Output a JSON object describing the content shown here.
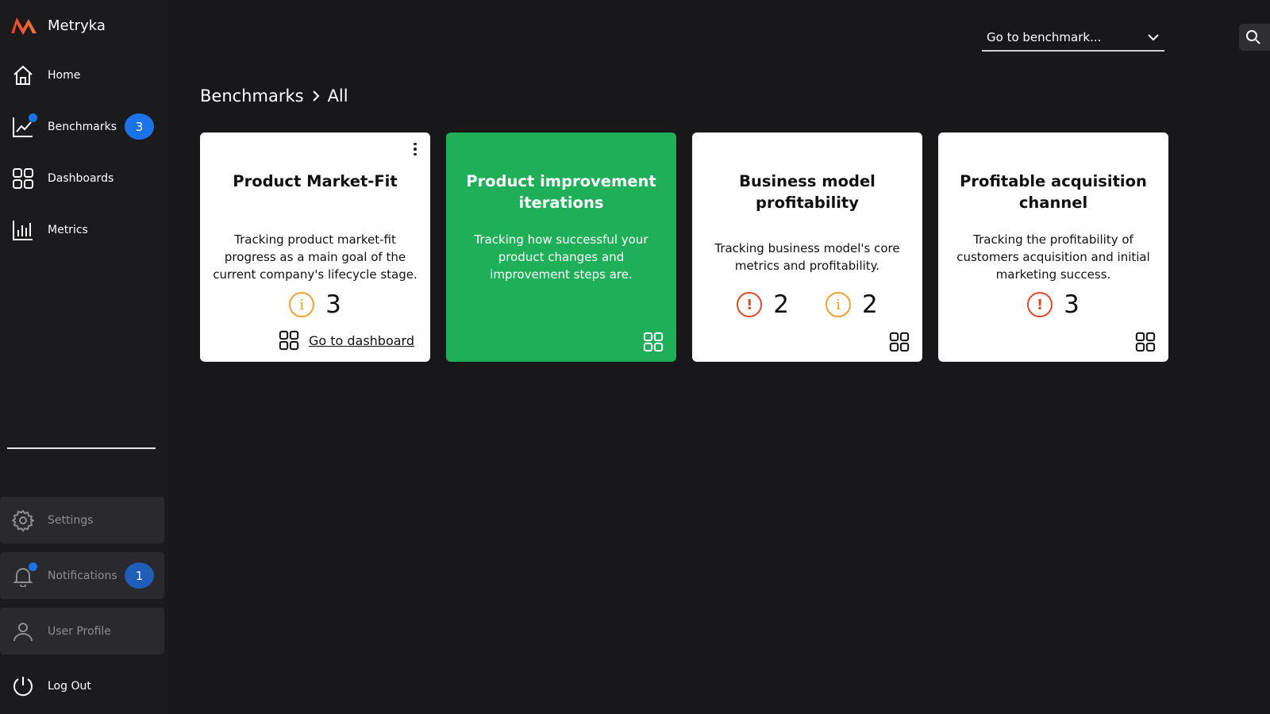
{
  "app": {
    "name": "Metryka",
    "accent": "#1a73e8"
  },
  "sidebar": {
    "items": [
      {
        "label": "Home",
        "icon": "home-icon"
      },
      {
        "label": "Benchmarks",
        "icon": "trending-chart-icon",
        "badge": "3"
      },
      {
        "label": "Dashboards",
        "icon": "grid-icon"
      },
      {
        "label": "Metrics",
        "icon": "bar-chart-icon"
      }
    ],
    "bottom": {
      "settings": "Settings",
      "notifications": "Notifications",
      "notifications_badge": "1",
      "profile": "User Profile",
      "logout": "Log Out"
    }
  },
  "header": {
    "goto_placeholder": "Go to benchmark...",
    "search_icon": "search-icon"
  },
  "breadcrumb": {
    "root": "Benchmarks",
    "current": "All"
  },
  "cards": [
    {
      "title": "Product Market-Fit",
      "description": "Tracking product market-fit progress as a main goal of the current company's lifecycle stage.",
      "stats": [
        {
          "type": "info",
          "value": "3"
        }
      ],
      "link": "Go to dashboard"
    },
    {
      "title": "Product improvement iterations",
      "description": "Tracking how successful your product changes and improvement steps are.",
      "stats": [],
      "color": "#1faf59"
    },
    {
      "title": "Business model profitability",
      "description": "Tracking business model's core metrics and profitability.",
      "stats": [
        {
          "type": "alert",
          "value": "2"
        },
        {
          "type": "info",
          "value": "2"
        }
      ]
    },
    {
      "title": "Profitable acquisition channel",
      "description": "Tracking the profitability of customers acquisition and initial marketing success.",
      "stats": [
        {
          "type": "alert",
          "value": "3"
        }
      ]
    }
  ]
}
